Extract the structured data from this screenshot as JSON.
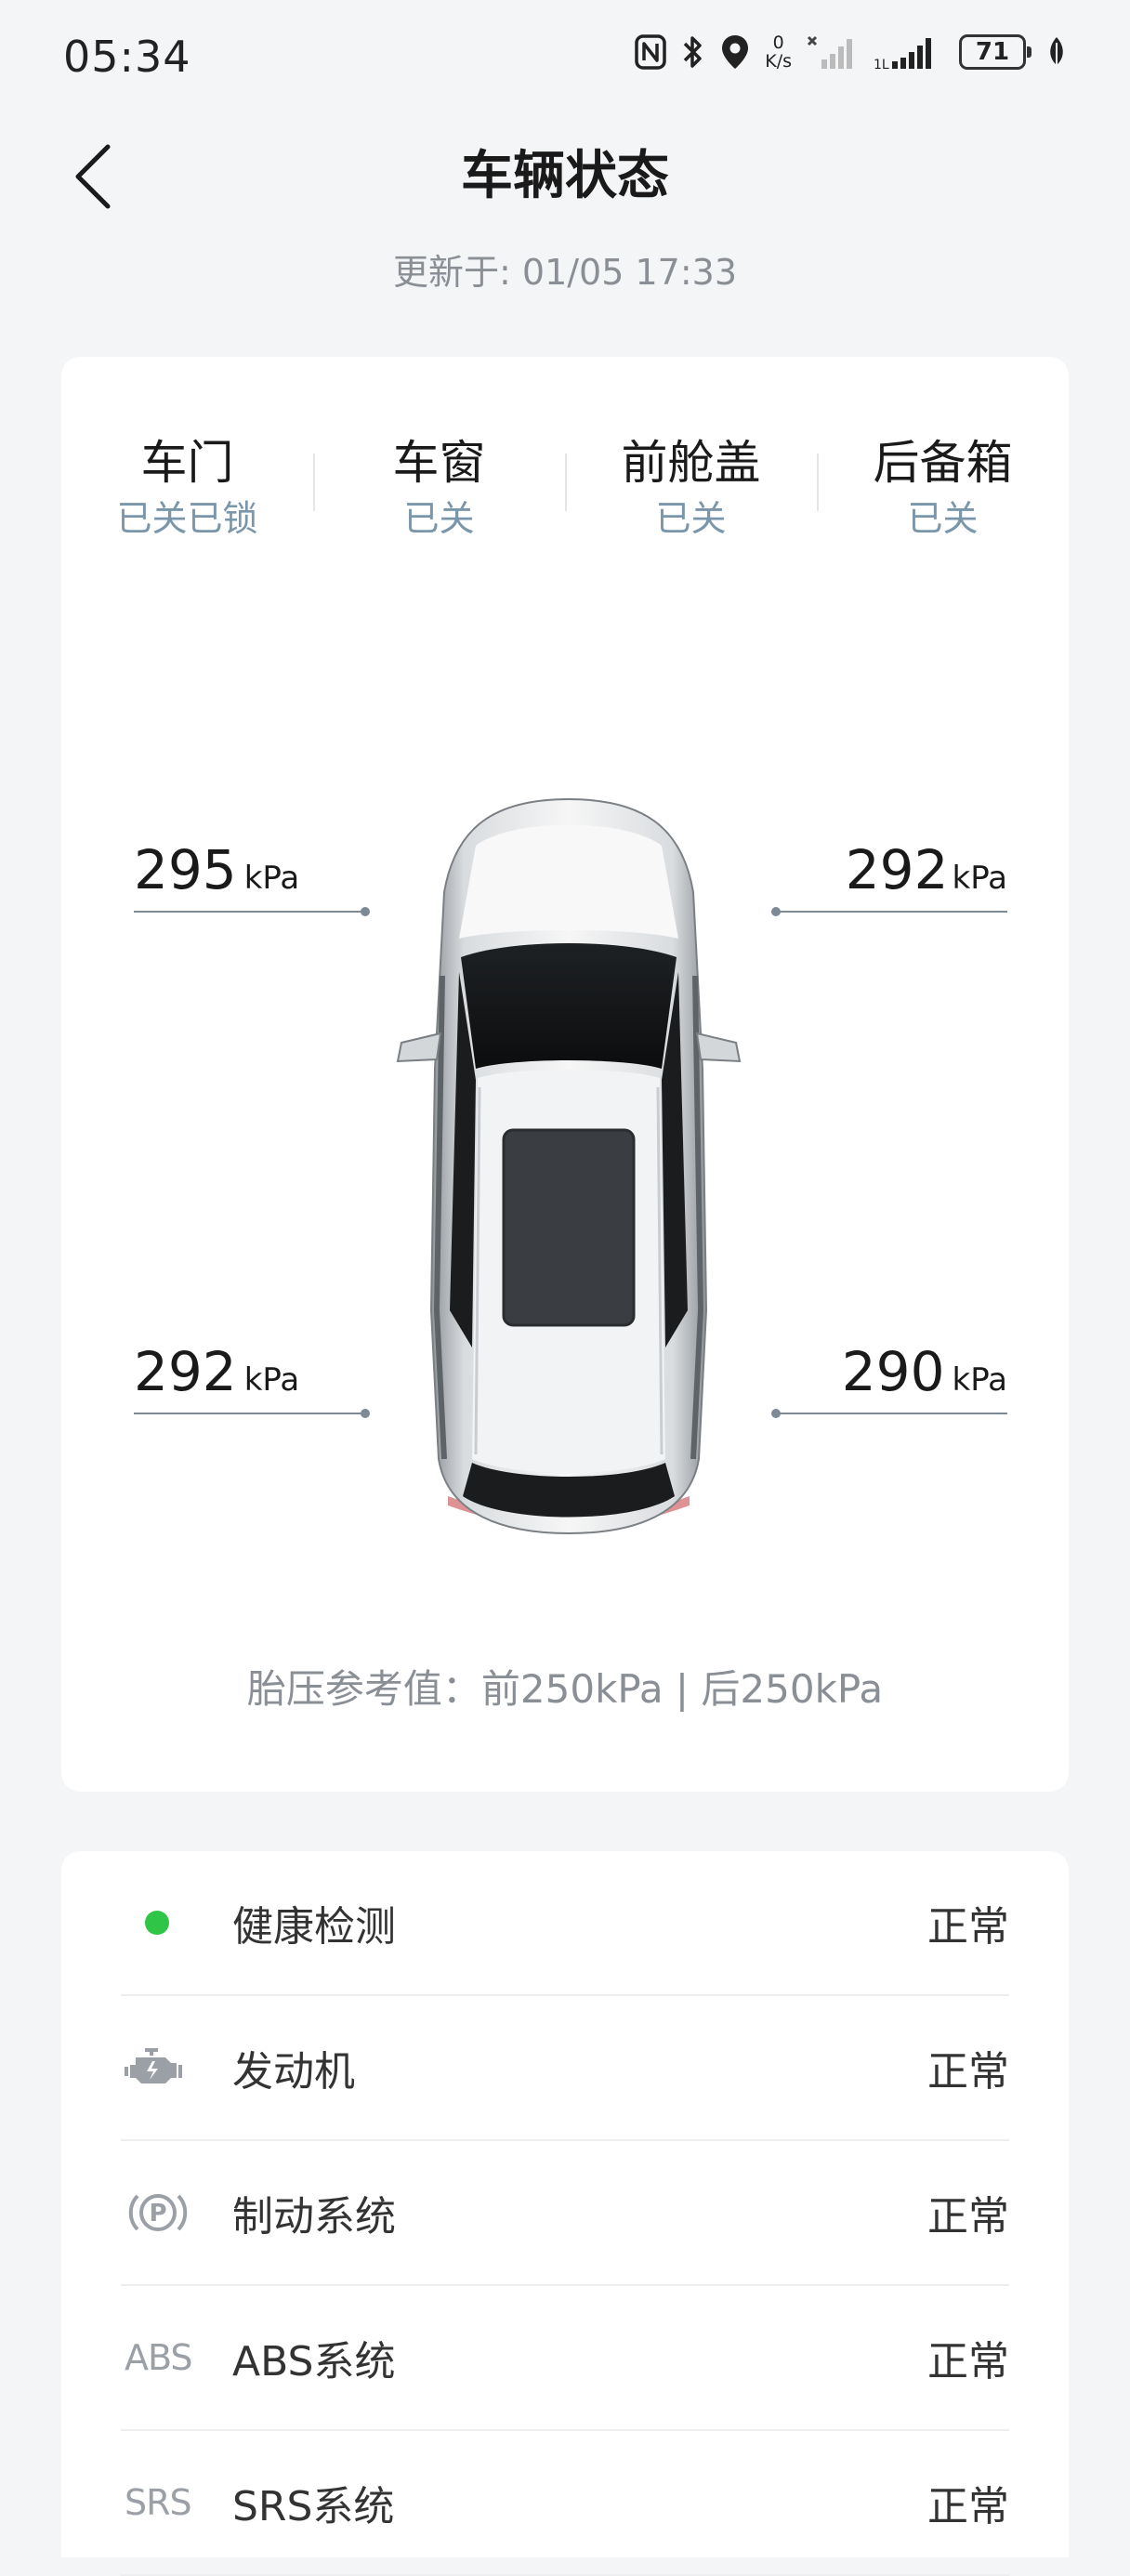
{
  "status_bar": {
    "time": "05:34",
    "speed_value": "0",
    "speed_unit": "K/s",
    "battery": "71",
    "icons": [
      "nfc-icon",
      "bluetooth-icon",
      "location-icon",
      "network-speed",
      "signal-off-icon",
      "signal-icon",
      "battery-icon",
      "leaf-icon"
    ]
  },
  "header": {
    "title": "车辆状态",
    "update_label": "更新于: ",
    "update_time": "01/05 17:33"
  },
  "door_status": [
    {
      "label": "车门",
      "value": "已关已锁"
    },
    {
      "label": "车窗",
      "value": "已关"
    },
    {
      "label": "前舱盖",
      "value": "已关"
    },
    {
      "label": "后备箱",
      "value": "已关"
    }
  ],
  "tires": {
    "front_left": {
      "value": "295",
      "unit": "kPa"
    },
    "front_right": {
      "value": "292",
      "unit": "kPa"
    },
    "rear_left": {
      "value": "292",
      "unit": "kPa"
    },
    "rear_right": {
      "value": "290",
      "unit": "kPa"
    }
  },
  "pressure_reference": "胎压参考值：前250kPa | 后250kPa",
  "systems": [
    {
      "icon": "green-dot-icon",
      "label": "健康检测",
      "status": "正常"
    },
    {
      "icon": "engine-icon",
      "label": "发动机",
      "status": "正常"
    },
    {
      "icon": "parking-brake-icon",
      "label": "制动系统",
      "status": "正常"
    },
    {
      "icon": "abs-icon",
      "icon_text": "ABS",
      "label": "ABS系统",
      "status": "正常"
    },
    {
      "icon": "srs-icon",
      "icon_text": "SRS",
      "label": "SRS系统",
      "status": "正常"
    }
  ],
  "colors": {
    "accent_status": "#7a96ab",
    "ok_green": "#2fc546",
    "background": "#f4f5f6"
  }
}
